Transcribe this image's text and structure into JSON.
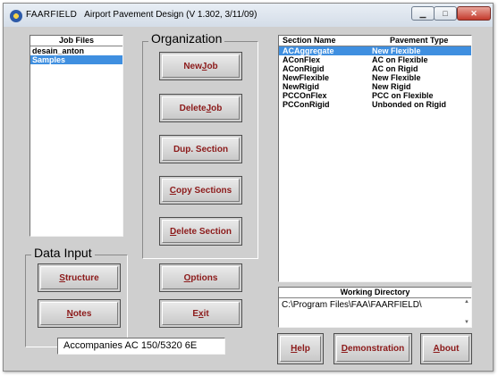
{
  "window": {
    "app_name": "FAARFIELD",
    "title": "Airport Pavement Design (V 1.302, 3/11/09)",
    "minimize_glyph": "▁",
    "maximize_glyph": "□",
    "close_glyph": "✕"
  },
  "job_files": {
    "header": "Job Files",
    "items": [
      {
        "label": "desain_anton",
        "selected": false
      },
      {
        "label": "Samples",
        "selected": true
      }
    ]
  },
  "organization": {
    "title": "Organization",
    "buttons": {
      "new_job": {
        "pre": "New ",
        "ul": "J",
        "post": "ob"
      },
      "delete_job": {
        "pre": "Delete ",
        "ul": "J",
        "post": "ob"
      },
      "dup_section": {
        "pre": "Dup. Section",
        "ul": "",
        "post": ""
      },
      "copy_sections": {
        "pre": "",
        "ul": "C",
        "post": "opy Sections"
      },
      "delete_section": {
        "pre": "",
        "ul": "D",
        "post": "elete Section"
      }
    }
  },
  "sections": {
    "col_name": "Section Name",
    "col_type": "Pavement Type",
    "rows": [
      {
        "name": "ACAggregate",
        "type": "New Flexible",
        "selected": true
      },
      {
        "name": "AConFlex",
        "type": "AC on Flexible",
        "selected": false
      },
      {
        "name": "AConRigid",
        "type": "AC on Rigid",
        "selected": false
      },
      {
        "name": "NewFlexible",
        "type": "New Flexible",
        "selected": false
      },
      {
        "name": "NewRigid",
        "type": "New Rigid",
        "selected": false
      },
      {
        "name": "PCCOnFlex",
        "type": "PCC on Flexible",
        "selected": false
      },
      {
        "name": "PCConRigid",
        "type": "Unbonded on Rigid",
        "selected": false
      }
    ]
  },
  "data_input": {
    "title": "Data Input",
    "structure": {
      "pre": "",
      "ul": "S",
      "post": "tructure"
    },
    "notes": {
      "pre": "",
      "ul": "N",
      "post": "otes"
    }
  },
  "middle_buttons": {
    "options": {
      "pre": "",
      "ul": "O",
      "post": "ptions"
    },
    "exit": {
      "pre": "E",
      "ul": "x",
      "post": "it"
    }
  },
  "working_directory": {
    "title": "Working Directory",
    "path": "C:\\Program Files\\FAA\\FAARFIELD\\"
  },
  "bottom_buttons": {
    "help": {
      "pre": "",
      "ul": "H",
      "post": "elp"
    },
    "demonstration": {
      "pre": "",
      "ul": "D",
      "post": "emonstration"
    },
    "about": {
      "pre": "",
      "ul": "A",
      "post": "bout"
    }
  },
  "footer": {
    "caption": "Accompanies AC 150/5320 6E"
  }
}
